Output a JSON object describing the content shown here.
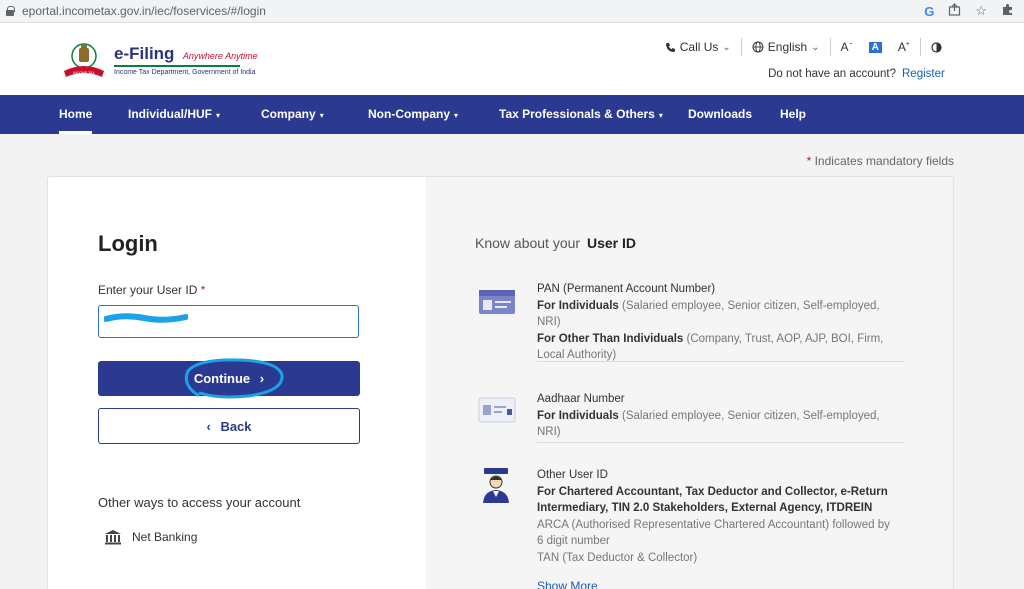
{
  "browser": {
    "url": "eportal.incometax.gov.in/iec/foservices/#/login"
  },
  "header": {
    "brand_title": "e-Filing",
    "brand_tagline": "Anywhere Anytime",
    "brand_subtitle": "Income Tax Department, Government of India",
    "call_us": "Call Us",
    "language": "English",
    "no_account_text": "Do not have an account?",
    "register_label": "Register"
  },
  "nav": {
    "items": [
      {
        "label": "Home"
      },
      {
        "label": "Individual/HUF"
      },
      {
        "label": "Company"
      },
      {
        "label": "Non-Company"
      },
      {
        "label": "Tax Professionals & Others"
      },
      {
        "label": "Downloads"
      },
      {
        "label": "Help"
      }
    ]
  },
  "mandatory_note": "Indicates mandatory fields",
  "login": {
    "title": "Login",
    "userid_label": "Enter your User ID",
    "userid_value": "",
    "continue_label": "Continue",
    "back_label": "Back",
    "other_ways": "Other ways to access your account",
    "net_banking": "Net Banking"
  },
  "know": {
    "title_prefix": "Know about your",
    "title_bold": "User ID",
    "pan": {
      "heading": "PAN (Permanent Account Number)",
      "ind_label": "For Individuals",
      "ind_text": "(Salaried employee, Senior citizen, Self-employed, NRI)",
      "other_label": "For Other Than Individuals",
      "other_text": "(Company, Trust, AOP, AJP, BOI, Firm, Local Authority)"
    },
    "aadhaar": {
      "heading": "Aadhaar Number",
      "ind_label": "For Individuals",
      "ind_text": "(Salaried employee, Senior citizen, Self-employed, NRI)"
    },
    "other": {
      "heading": "Other User ID",
      "bold_text": "For Chartered Accountant, Tax Deductor and Collector, e-Return Intermediary, TIN 2.0 Stakeholders, External Agency, ITDREIN",
      "arca_text": "ARCA (Authorised Representative Chartered Accountant) followed by 6 digit number",
      "tan_text": "TAN (Tax Deductor & Collector)"
    },
    "show_more": "Show More"
  },
  "colors": {
    "primary": "#2b3990",
    "accent_red": "#c8102e",
    "link": "#1a5fb4",
    "annotation": "#1aa3e8"
  }
}
